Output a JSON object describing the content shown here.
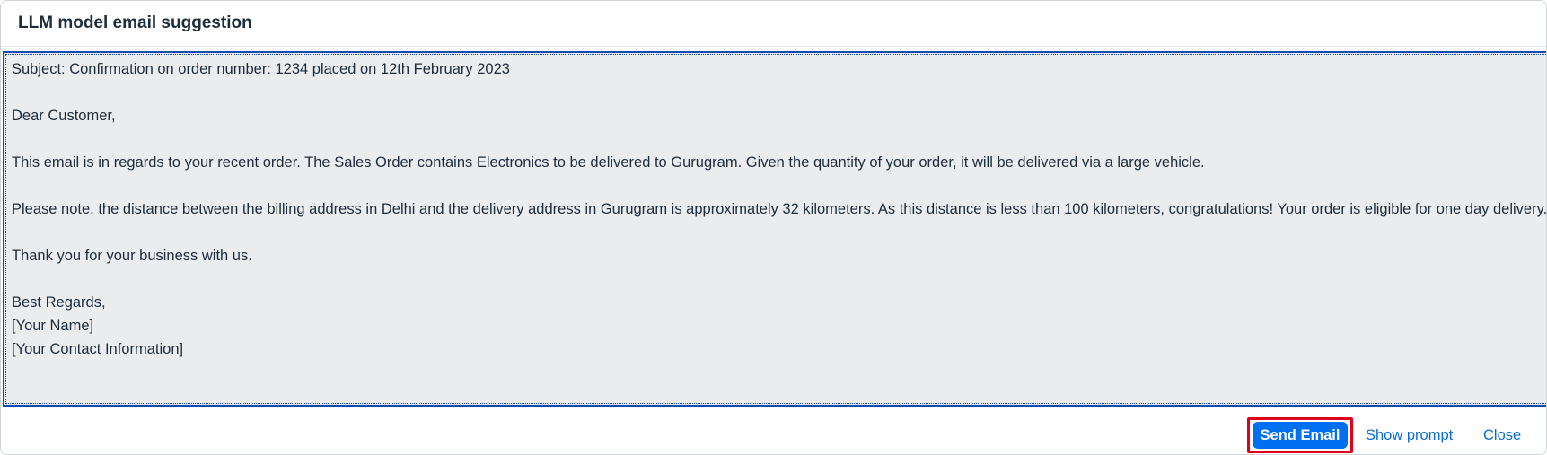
{
  "dialog": {
    "title": "LLM model email suggestion"
  },
  "email": {
    "body": "Subject: Confirmation on order number: 1234 placed on 12th February 2023\n\nDear Customer,\n\nThis email is in regards to your recent order. The Sales Order contains Electronics to be delivered to Gurugram. Given the quantity of your order, it will be delivered via a large vehicle.\n\nPlease note, the distance between the billing address in Delhi and the delivery address in Gurugram is approximately 32 kilometers. As this distance is less than 100 kilometers, congratulations! Your order is eligible for one day delivery.\n\nThank you for your business with us.\n\nBest Regards,\n[Your Name]\n[Your Contact Information]"
  },
  "footer": {
    "send_label": "Send Email",
    "show_prompt_label": "Show prompt",
    "close_label": "Close"
  },
  "colors": {
    "primary": "#0070f2",
    "link": "#0a6ed1",
    "highlight": "#e0001b",
    "textarea_bg": "#eaecee",
    "focus_border": "#0a4bb4"
  }
}
